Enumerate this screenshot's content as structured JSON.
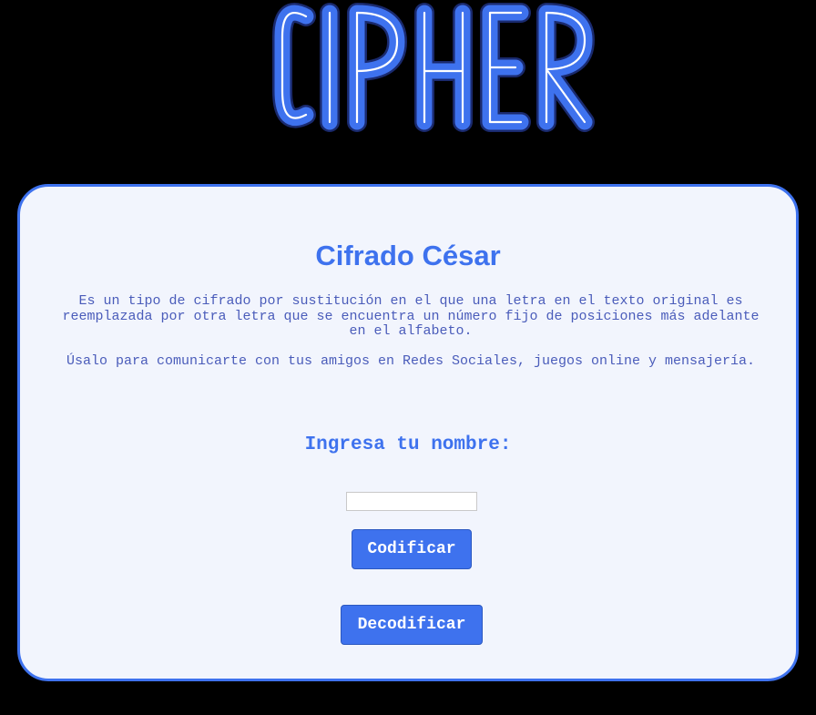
{
  "header": {
    "logo_text": "CIPHER",
    "logo_color": "#3e72ee"
  },
  "card": {
    "title": "Cifrado César",
    "description": "Es un tipo de cifrado por sustitución en el que una letra en el texto original es reemplazada por otra letra que se encuentra un número fijo de posiciones más adelante en el alfabeto.",
    "usage": "Úsalo para comunicarte con tus amigos en Redes Sociales, juegos online y mensajería.",
    "prompt": "Ingresa tu nombre:",
    "name_value": "",
    "encode_label": "Codificar",
    "decode_label": "Decodificar"
  },
  "colors": {
    "background": "#000000",
    "accent": "#3e72ee",
    "card_background": "#f2f5fd",
    "body_text": "#4a5cba"
  }
}
